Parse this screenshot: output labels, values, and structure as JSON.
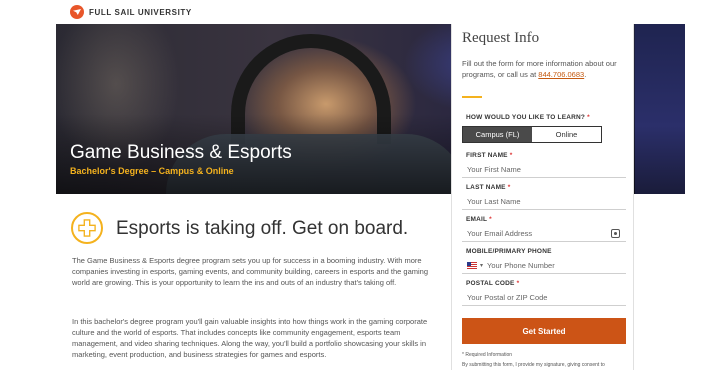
{
  "header": {
    "logo_text": "FULL SAIL UNIVERSITY",
    "logo_icon": "full-sail-logo-icon"
  },
  "hero": {
    "title": "Game Business & Esports",
    "subtitle": "Bachelor's Degree – Campus & Online"
  },
  "main": {
    "section_icon": "game-controller-icon",
    "section_title": "Esports is taking off. Get on board.",
    "paragraph1": "The Game Business & Esports degree program sets you up for success in a booming industry. With more companies investing in esports, gaming events, and community building, careers in esports and the gaming world are growing. This is your opportunity to learn the ins and outs of an industry that's taking off.",
    "paragraph2": "In this bachelor's degree program you'll gain valuable insights into how things work in the gaming corporate culture and the world of esports. That includes concepts like community engagement, esports team management, and video sharing techniques. Along the way, you'll build a portfolio showcasing your skills in marketing, event production, and business strategies for games and esports."
  },
  "form": {
    "title": "Request Info",
    "intro_text": "Fill out the form for more information about our programs, or call us at",
    "phone": "844.706.0683",
    "intro_suffix": ".",
    "learn_label": "HOW WOULD YOU LIKE TO LEARN?",
    "required_mark": "*",
    "learn_options": [
      "Campus (FL)",
      "Online"
    ],
    "learn_selected": "Campus (FL)",
    "first_name_label": "FIRST NAME",
    "first_name_placeholder": "Your First Name",
    "last_name_label": "LAST NAME",
    "last_name_placeholder": "Your Last Name",
    "email_label": "EMAIL",
    "email_placeholder": "Your Email Address",
    "phone_label": "MOBILE/PRIMARY PHONE",
    "phone_placeholder": "Your Phone Number",
    "postal_label": "POSTAL CODE",
    "postal_placeholder": "Your Postal or ZIP Code",
    "submit_label": "Get Started",
    "required_note": "* Required Information",
    "consent_text": "By submitting this form, I provide my signature, giving consent to"
  },
  "colors": {
    "accent_orange": "#cc5416",
    "accent_gold": "#f4b21e",
    "link": "#c55a11"
  }
}
